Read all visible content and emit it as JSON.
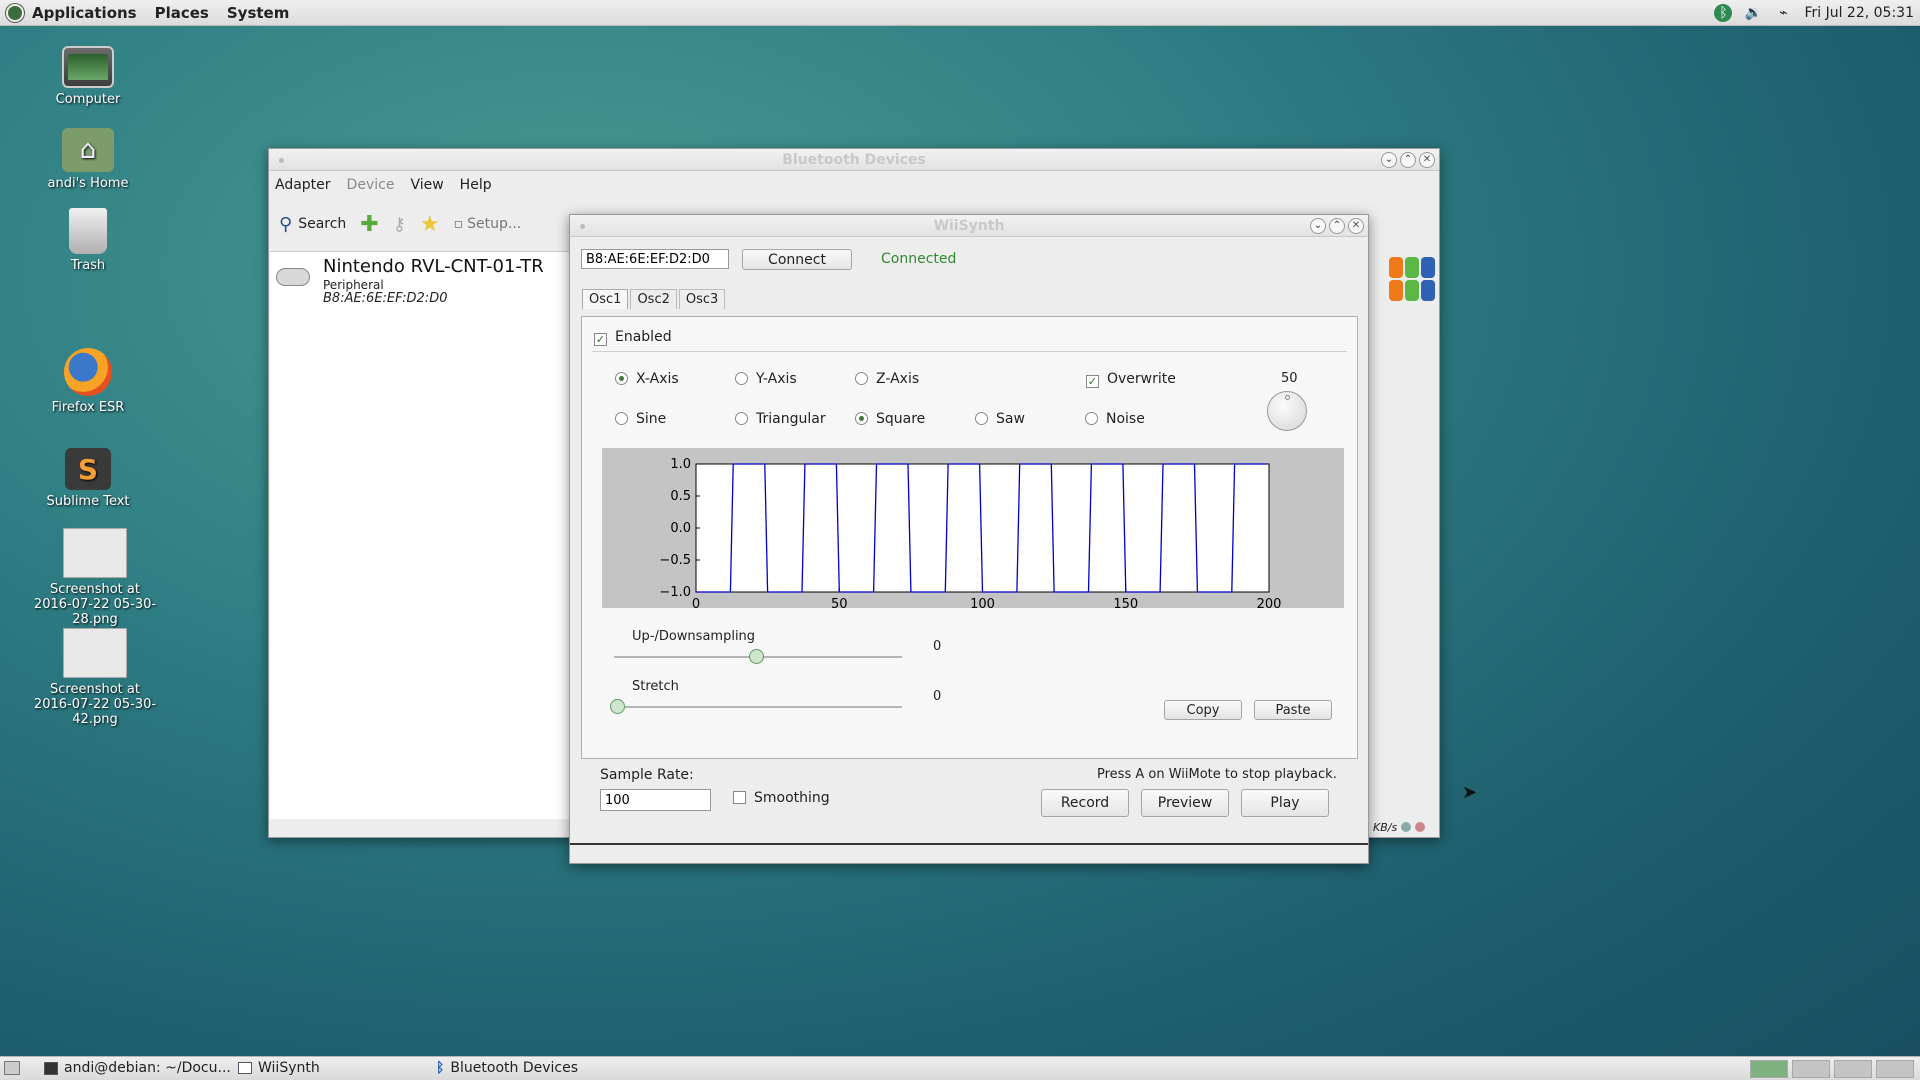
{
  "top_panel": {
    "menus": [
      "Applications",
      "Places",
      "System"
    ],
    "datetime": "Fri Jul 22, 05:31"
  },
  "desktop": {
    "icons": [
      {
        "label": "Computer",
        "icon": "computer-icon"
      },
      {
        "label": "andi's Home",
        "icon": "home-folder-icon"
      },
      {
        "label": "Trash",
        "icon": "trash-icon"
      },
      {
        "label": "Firefox ESR",
        "icon": "firefox-icon"
      },
      {
        "label": "Sublime Text",
        "icon": "sublime-text-icon"
      },
      {
        "label": "Screenshot at 2016-07-22 05-30-28.png",
        "icon": "image-thumbnail-icon"
      },
      {
        "label": "Screenshot at 2016-07-22 05-30-42.png",
        "icon": "image-thumbnail-icon"
      }
    ]
  },
  "bluetooth": {
    "title": "Bluetooth Devices",
    "menu": [
      "Adapter",
      "Device",
      "View",
      "Help"
    ],
    "toolbar": {
      "search": "Search",
      "setup": "Setup..."
    },
    "device": {
      "name": "Nintendo RVL-CNT-01-TR",
      "type": "Peripheral",
      "mac": "B8:AE:6E:EF:D2:D0"
    },
    "status_unit": "KB/s"
  },
  "wiisynth": {
    "title": "WiiSynth",
    "address_value": "B8:AE:6E:EF:D2:D0",
    "connect_label": "Connect",
    "status": "Connected",
    "tabs": [
      "Osc1",
      "Osc2",
      "Osc3"
    ],
    "active_tab": "Osc1",
    "enabled_label": "Enabled",
    "enabled": true,
    "axes": [
      "X-Axis",
      "Y-Axis",
      "Z-Axis"
    ],
    "selected_axis": "X-Axis",
    "overwrite_label": "Overwrite",
    "overwrite": true,
    "dial_value": "50",
    "waveforms": [
      "Sine",
      "Triangular",
      "Square",
      "Saw",
      "Noise"
    ],
    "selected_waveform": "Square",
    "updown_label": "Up-/Downsampling",
    "updown_value": "0",
    "stretch_label": "Stretch",
    "stretch_value": "0",
    "copy_label": "Copy",
    "paste_label": "Paste",
    "sample_rate_label": "Sample Rate:",
    "sample_rate_value": "100",
    "smoothing_label": "Smoothing",
    "smoothing": false,
    "hint": "Press A on WiiMote to stop playback.",
    "record_label": "Record",
    "preview_label": "Preview",
    "play_label": "Play"
  },
  "chart_data": {
    "type": "line",
    "xlim": [
      0,
      200
    ],
    "ylim": [
      -1.0,
      1.0
    ],
    "xticks": [
      "0",
      "50",
      "100",
      "150",
      "200"
    ],
    "yticks": [
      "1.0",
      "0.5",
      "0.0",
      "−0.5",
      "−1.0"
    ],
    "series": [
      {
        "color": "#0000cc",
        "x": [
          0,
          12,
          13,
          24,
          25,
          37,
          38,
          49,
          50,
          62,
          63,
          74,
          75,
          87,
          88,
          99,
          100,
          112,
          113,
          124,
          125,
          137,
          138,
          149,
          150,
          162,
          163,
          174,
          175,
          187,
          188,
          199
        ],
        "y": [
          -1,
          -1,
          1,
          1,
          -1,
          -1,
          1,
          1,
          -1,
          -1,
          1,
          1,
          -1,
          -1,
          1,
          1,
          -1,
          -1,
          1,
          1,
          -1,
          -1,
          1,
          1,
          -1,
          -1,
          1,
          1,
          -1,
          -1,
          1,
          1
        ]
      }
    ],
    "grid": false
  },
  "taskbar": {
    "items": [
      {
        "label": "andi@debian: ~/Docu...",
        "icon": "terminal-icon"
      },
      {
        "label": "WiiSynth",
        "icon": "window-icon"
      },
      {
        "label": "Bluetooth Devices",
        "icon": "bluetooth-icon"
      }
    ]
  }
}
